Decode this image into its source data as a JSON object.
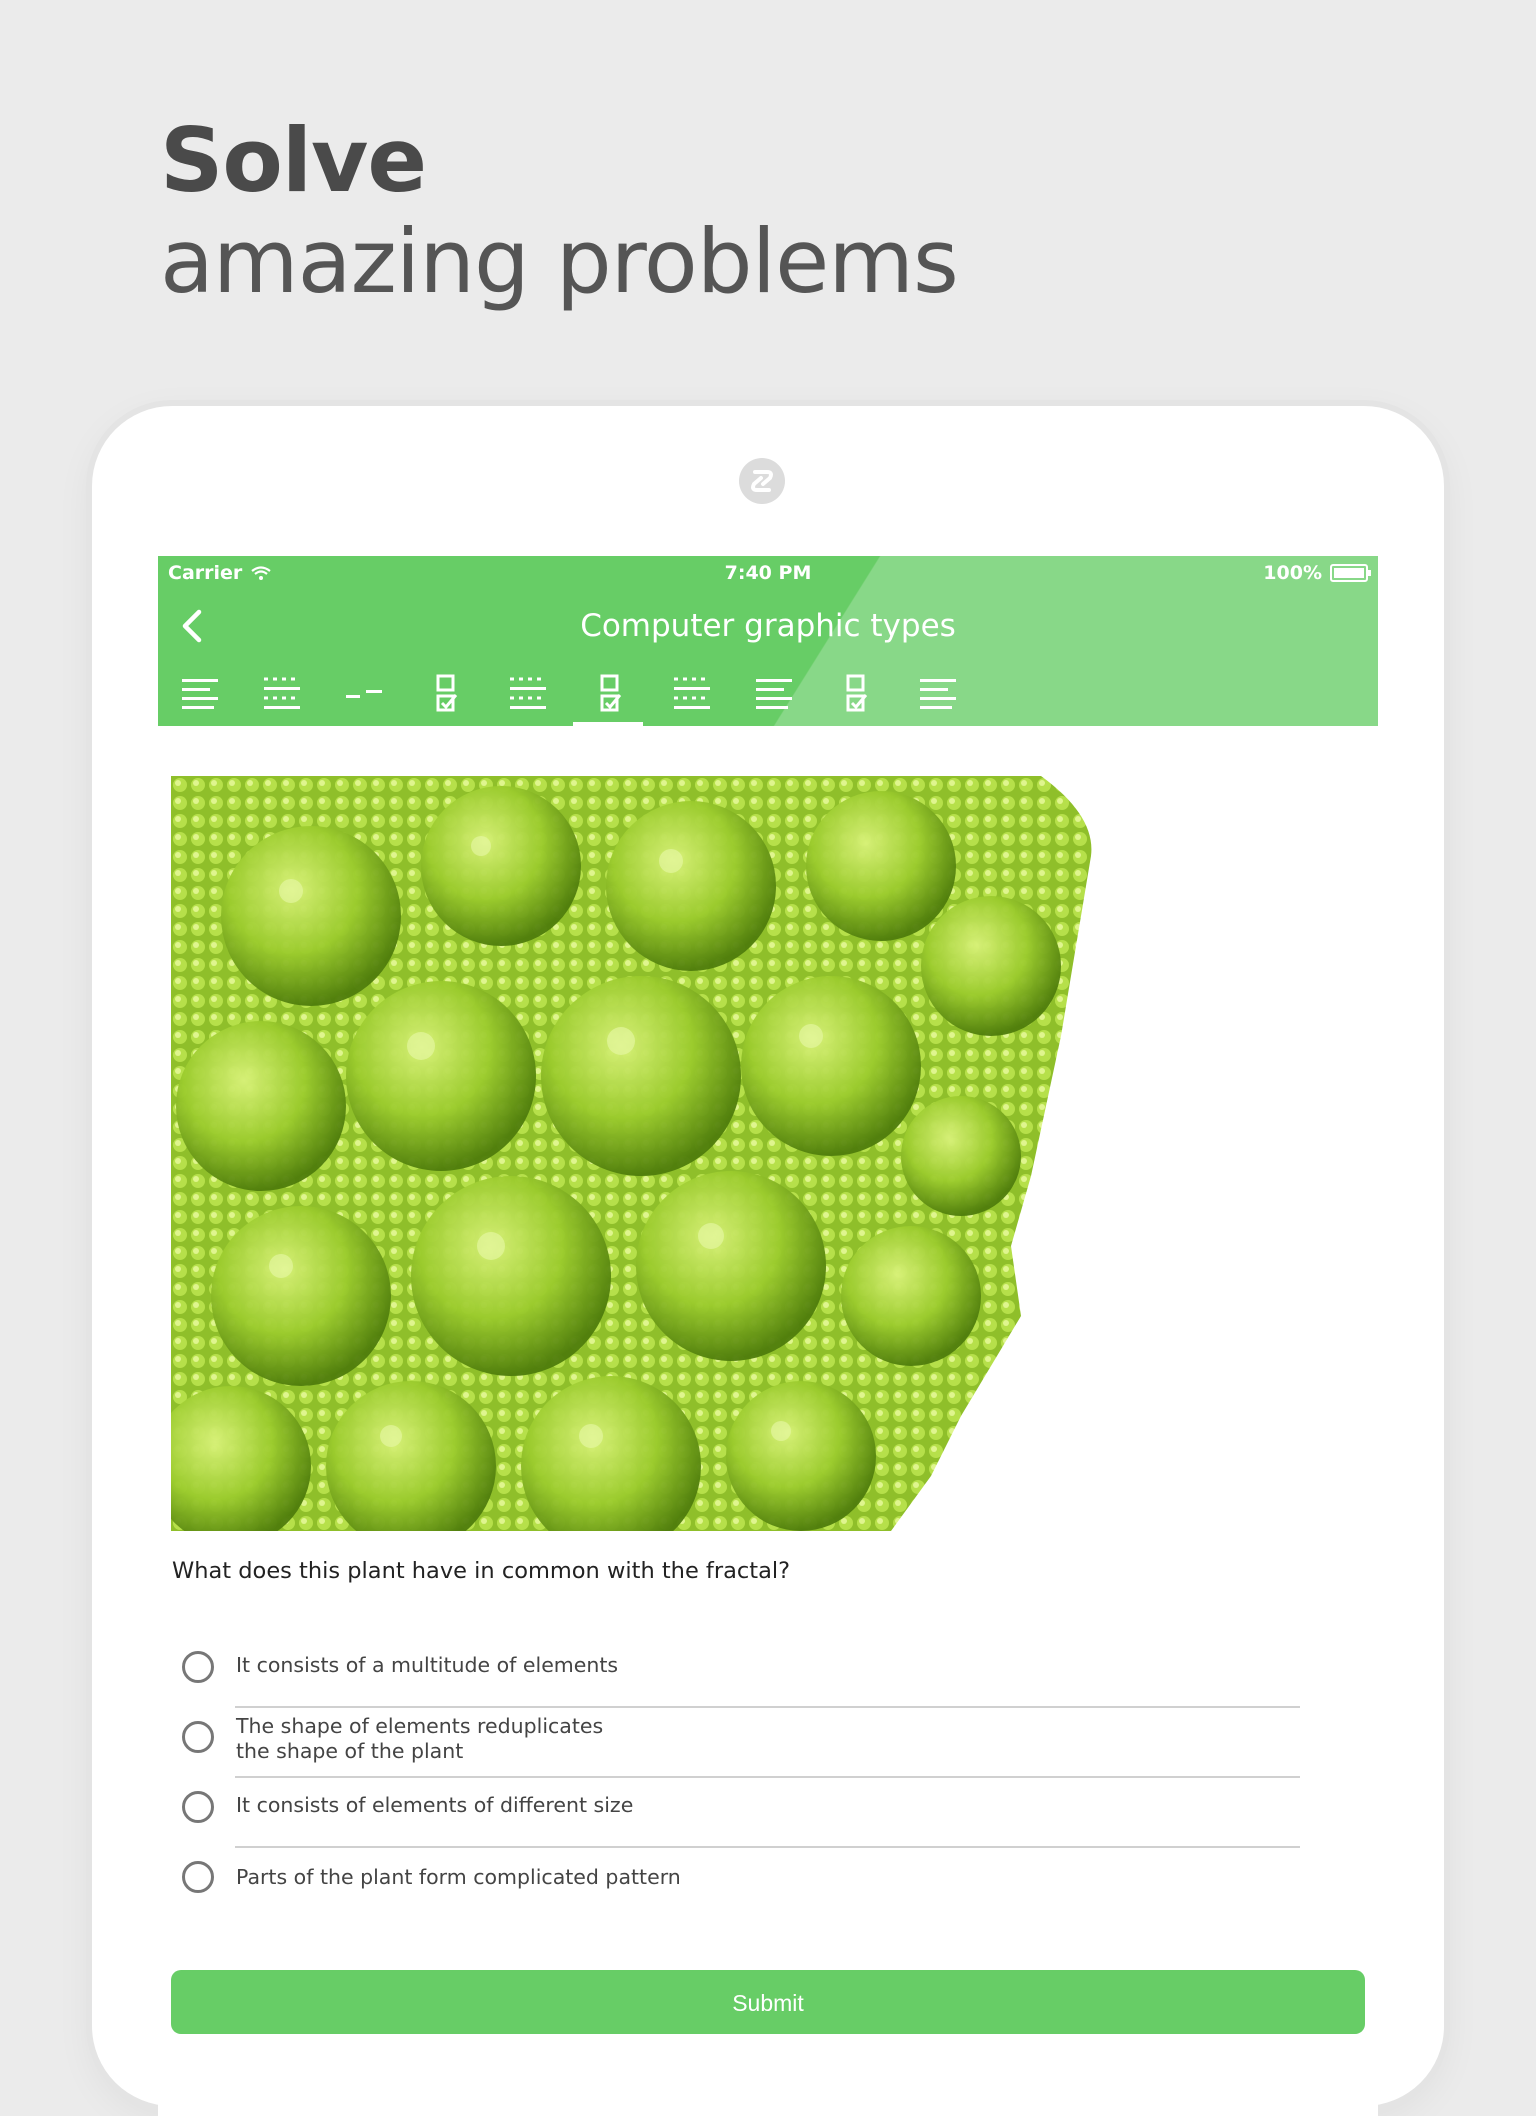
{
  "marketing": {
    "headline_bold": "Solve",
    "headline_light": "amazing problems"
  },
  "status_bar": {
    "carrier": "Carrier",
    "time": "7:40 PM",
    "battery": "100%"
  },
  "header": {
    "title": "Computer graphic types",
    "back_icon": "chevron-left-icon"
  },
  "tabs": [
    {
      "icon": "text-lines-icon"
    },
    {
      "icon": "dotted-lines-icon"
    },
    {
      "icon": "dash-lines-icon"
    },
    {
      "icon": "checkbox-icon"
    },
    {
      "icon": "dotted-lines-icon"
    },
    {
      "icon": "checkbox-icon",
      "active": true
    },
    {
      "icon": "dotted-lines-icon"
    },
    {
      "icon": "text-lines-icon"
    },
    {
      "icon": "checkbox-icon"
    },
    {
      "icon": "text-lines-icon"
    }
  ],
  "quiz": {
    "question": "What does this plant have in common with the fractal?",
    "options": [
      {
        "line1": "It consists of a multitude of elements",
        "line2": ""
      },
      {
        "line1": "The shape of elements reduplicates",
        "line2": "the shape of the plant"
      },
      {
        "line1": "It consists of elements of different size",
        "line2": ""
      },
      {
        "line1": "Parts of the plant form complicated pattern",
        "line2": ""
      }
    ],
    "submit_label": "Submit"
  },
  "colors": {
    "accent": "#67cd66",
    "background": "#ebebeb"
  }
}
